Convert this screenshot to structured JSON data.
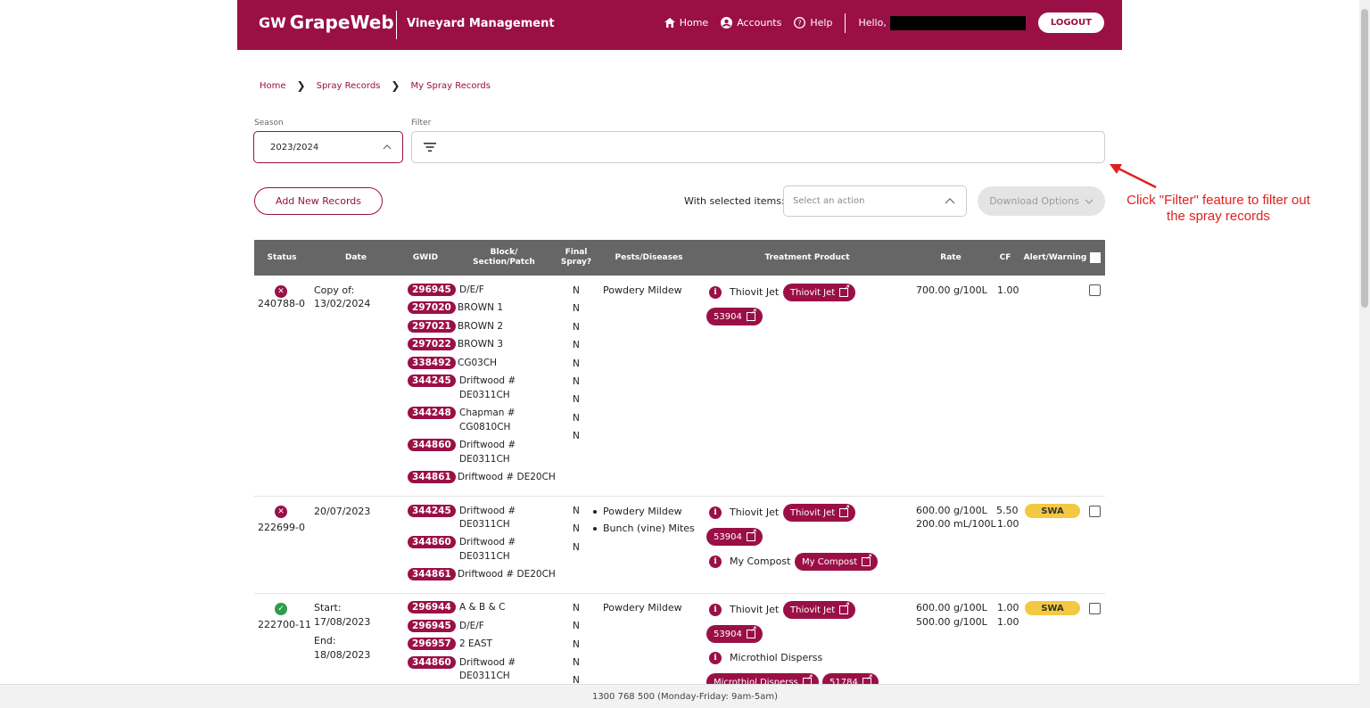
{
  "header": {
    "logo_mark": "GW",
    "logo_text": "GrapeWeb",
    "app_title": "Vineyard Management",
    "nav_home": "Home",
    "nav_accounts": "Accounts",
    "nav_help": "Help",
    "hello": "Hello,",
    "logout": "LOGOUT"
  },
  "breadcrumb": {
    "home": "Home",
    "spray_records": "Spray Records",
    "my_spray_records": "My Spray Records"
  },
  "season": {
    "label": "Season",
    "value": "2023/2024"
  },
  "filter": {
    "label": "Filter"
  },
  "actions": {
    "add_new": "Add New Records",
    "with_selected": "With selected items:",
    "select_placeholder": "Select an action",
    "download": "Download Options"
  },
  "annotation": {
    "text": "Click \"Filter\" feature to filter out the spray records",
    "color": "#e02020"
  },
  "columns": [
    "Status",
    "Date",
    "GWID",
    "Block/ Section/Patch",
    "Final Spray?",
    "Pests/Diseases",
    "Treatment Product",
    "Rate",
    "CF",
    "Alert/Warning"
  ],
  "rows": [
    {
      "id": "240788-0",
      "date": [
        "Copy of:",
        "13/02/2024"
      ],
      "gwids": [
        "296945",
        "297020",
        "297021",
        "297022",
        "338492",
        "344245",
        "344248",
        "344860",
        "344861"
      ],
      "blocks": [
        "D/E/F",
        "BROWN 1",
        "BROWN 2",
        "BROWN 3",
        "CG03CH",
        "Driftwood #",
        "DE0311CH",
        "Chapman #",
        "CG0810CH",
        "Driftwood #",
        "DE0311CH",
        "Driftwood # DE20CH"
      ],
      "final": [
        "N",
        "N",
        "N",
        "N",
        "N",
        "N",
        "N",
        "N",
        "N"
      ],
      "pests": [
        "Powdery Mildew"
      ],
      "product": "Thiovit Jet",
      "product_link": "Thiovit Jet",
      "product_code": "53904",
      "rate": [
        "700.00 g/100L"
      ],
      "cf": [
        "1.00"
      ]
    },
    {
      "id": "222699-0",
      "date": [
        "20/07/2023"
      ],
      "gwids": [
        "344245",
        "344860",
        "344861"
      ],
      "blocks": [
        "Driftwood #",
        "DE0311CH",
        "Driftwood #",
        "DE0311CH",
        "Driftwood # DE20CH"
      ],
      "final": [
        "N",
        "N",
        "N"
      ],
      "pests": [
        "Powdery Mildew",
        "Bunch (vine) Mites"
      ],
      "product": "Thiovit Jet",
      "product_link": "Thiovit Jet",
      "product_code": "53904",
      "product2": "My Compost",
      "product2_link": "My Compost",
      "rate": [
        "600.00 g/100L",
        "200.00 mL/100L"
      ],
      "cf": [
        "5.50",
        "1.00"
      ],
      "alert": "SWA"
    },
    {
      "id": "222700-11",
      "date": [
        "Start:",
        "17/08/2023",
        "End:",
        "18/08/2023"
      ],
      "gwids": [
        "296944",
        "296945",
        "296957",
        "344860"
      ],
      "blocks": [
        "A & B & C",
        "D/E/F",
        "2 EAST",
        "Driftwood #",
        "DE0311CH"
      ],
      "final": [
        "N",
        "N",
        "N",
        "N",
        "N"
      ],
      "pests": [
        "Powdery Mildew"
      ],
      "product": "Thiovit Jet",
      "product_link": "Thiovit Jet",
      "product_code": "53904",
      "product2": "Microthiol Disperss",
      "product2_link": "Microthiol Disperss",
      "product2_code": "51784",
      "rate": [
        "600.00 g/100L",
        "500.00 g/100L"
      ],
      "cf": [
        "1.00",
        "1.00"
      ],
      "alert": "SWA"
    }
  ],
  "footer": {
    "phone": "1300 768 500 (Monday-Friday: 9am-5am)"
  },
  "colors": {
    "brand": "#9a1046",
    "table_head": "#666666",
    "alert": "#f5c842",
    "ok": "#2e9c4a"
  }
}
